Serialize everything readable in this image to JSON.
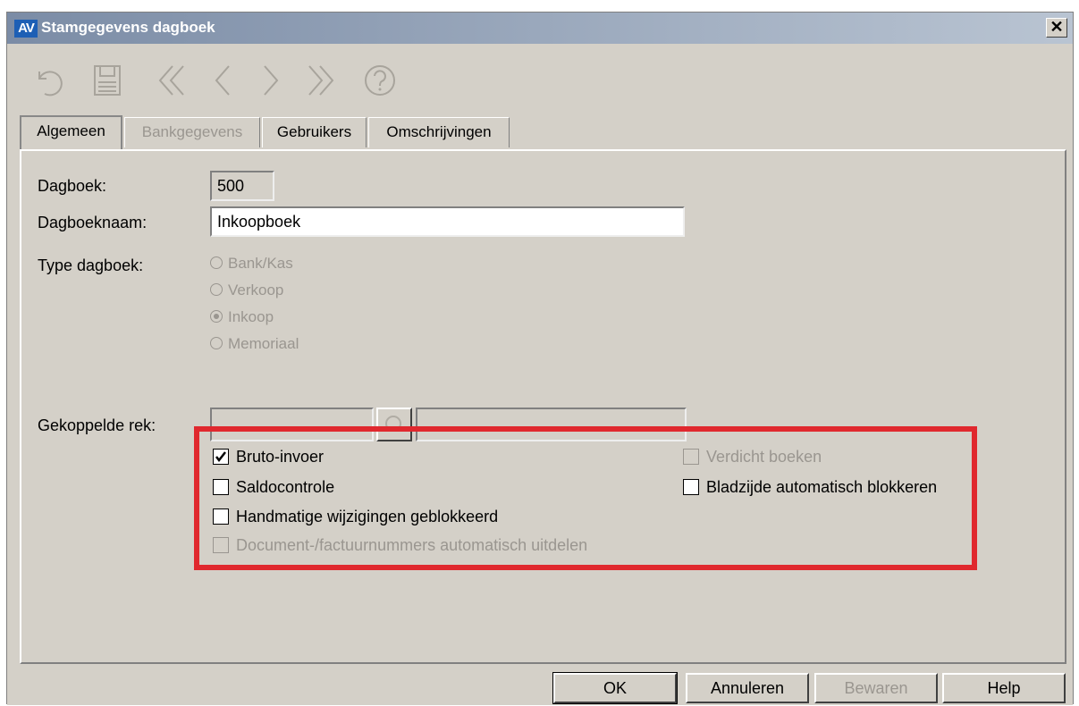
{
  "window": {
    "title": "Stamgegevens dagboek",
    "logo": "AV"
  },
  "toolbar": {
    "icons": [
      "undo-icon",
      "save-icon",
      "first-icon",
      "previous-icon",
      "next-icon",
      "last-icon",
      "help-icon"
    ]
  },
  "tabs": [
    {
      "label": "Algemeen",
      "state": "active"
    },
    {
      "label": "Bankgegevens",
      "state": "disabled"
    },
    {
      "label": "Gebruikers",
      "state": "normal"
    },
    {
      "label": "Omschrijvingen",
      "state": "normal"
    }
  ],
  "form": {
    "dagboek_label": "Dagboek:",
    "dagboek_value": "500",
    "dagboeknaam_label": "Dagboeknaam:",
    "dagboeknaam_value": "Inkoopboek",
    "type_label": "Type dagboek:",
    "type_options": [
      {
        "label": "Bank/Kas",
        "selected": false
      },
      {
        "label": "Verkoop",
        "selected": false
      },
      {
        "label": "Inkoop",
        "selected": true
      },
      {
        "label": "Memoriaal",
        "selected": false
      }
    ],
    "gekoppelde_label": "Gekoppelde rek:",
    "gekoppelde_value": "",
    "gekoppelde_description": ""
  },
  "checkboxes": {
    "bruto": {
      "label": "Bruto-invoer",
      "checked": true,
      "enabled": true
    },
    "saldo": {
      "label": "Saldocontrole",
      "checked": false,
      "enabled": true
    },
    "handmatig": {
      "label": "Handmatige wijzigingen geblokkeerd",
      "checked": false,
      "enabled": true
    },
    "document": {
      "label": "Document-/factuurnummers automatisch uitdelen",
      "checked": false,
      "enabled": false
    },
    "verdicht": {
      "label": "Verdicht boeken",
      "checked": false,
      "enabled": false
    },
    "bladzijde": {
      "label": "Bladzijde automatisch blokkeren",
      "checked": false,
      "enabled": true
    }
  },
  "buttons": {
    "ok": "OK",
    "annuleren": "Annuleren",
    "bewaren": "Bewaren",
    "help": "Help"
  },
  "colors": {
    "highlight": "#e0282e",
    "face": "#d4d0c8",
    "disabled_text": "#9a9690"
  }
}
